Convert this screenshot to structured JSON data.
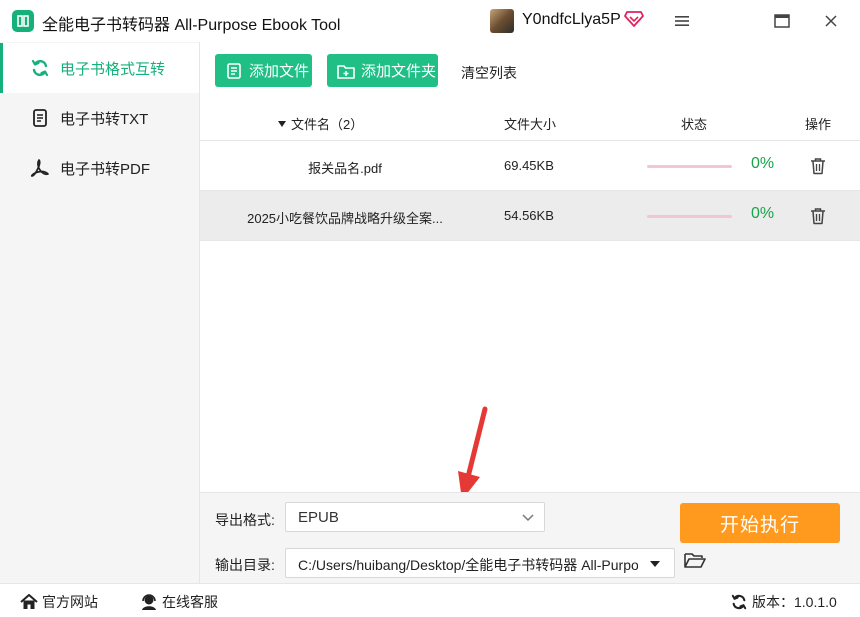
{
  "titlebar": {
    "title": "全能电子书转码器 All-Purpose Ebook Tool",
    "user_name": "Y0ndfcLlya5P",
    "logo_icon": "book-logo-icon",
    "vip_icon": "diamond-heart-icon"
  },
  "sidebar": {
    "items": [
      {
        "label": "电子书格式互转",
        "icon": "refresh-icon",
        "active": true
      },
      {
        "label": "电子书转TXT",
        "icon": "document-icon",
        "active": false
      },
      {
        "label": "电子书转PDF",
        "icon": "pdf-icon",
        "active": false
      }
    ]
  },
  "toolbar": {
    "add_file_label": "添加文件",
    "add_folder_label": "添加文件夹",
    "clear_label": "清空列表"
  },
  "table": {
    "headers": {
      "name": "文件名（2）",
      "size": "文件大小",
      "status": "状态",
      "action": "操作"
    },
    "rows": [
      {
        "name": "报关品名.pdf",
        "size": "69.45KB",
        "progress": 0,
        "percent": "0%"
      },
      {
        "name": "2025小吃餐饮品牌战略升级全案...",
        "size": "54.56KB",
        "progress": 0,
        "percent": "0%"
      }
    ]
  },
  "settings": {
    "format_label": "导出格式:",
    "format_value": "EPUB",
    "dir_label": "输出目录:",
    "dir_value": "C:/Users/huibang/Desktop/全能电子书转码器 All-Purpose Ebook Tool",
    "start_label": "开始执行"
  },
  "footer": {
    "site_label": "官方网站",
    "service_label": "在线客服",
    "version_label": "版本：1.0.1.0"
  },
  "colors": {
    "accent_green": "#1fbf86",
    "start_orange": "#ff9a1f",
    "percent_green": "#16a34a",
    "progress_track": "#f2c6d3",
    "arrow_red": "#e53935"
  }
}
